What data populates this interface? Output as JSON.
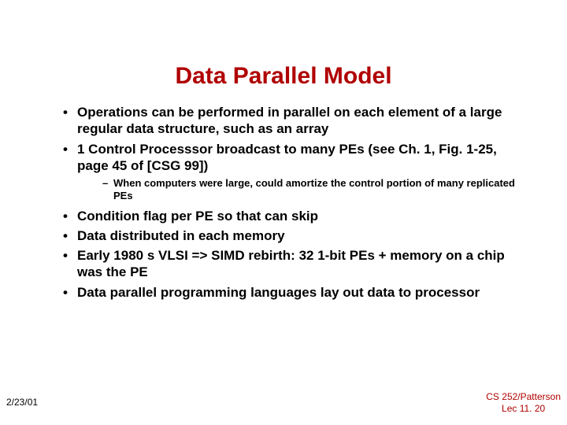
{
  "title": "Data Parallel Model",
  "bullets": {
    "b1": "Operations can be performed in parallel on each element of a large regular data structure, such as an array",
    "b2": "1 Control Processsor broadcast to many PEs (see Ch. 1, Fig. 1-25, page 45 of [CSG 99])",
    "b2_sub": "When computers were large, could amortize the control portion of many replicated PEs",
    "b3": "Condition flag per PE so that can skip",
    "b4": "Data distributed in each memory",
    "b5": "Early 1980 s VLSI => SIMD rebirth: 32 1-bit PEs + memory on a chip was the PE",
    "b6": "Data parallel programming languages lay out data to processor"
  },
  "footer": {
    "left": "2/23/01",
    "right_line1": "CS 252/Patterson",
    "right_line2": "Lec 11. 20"
  }
}
